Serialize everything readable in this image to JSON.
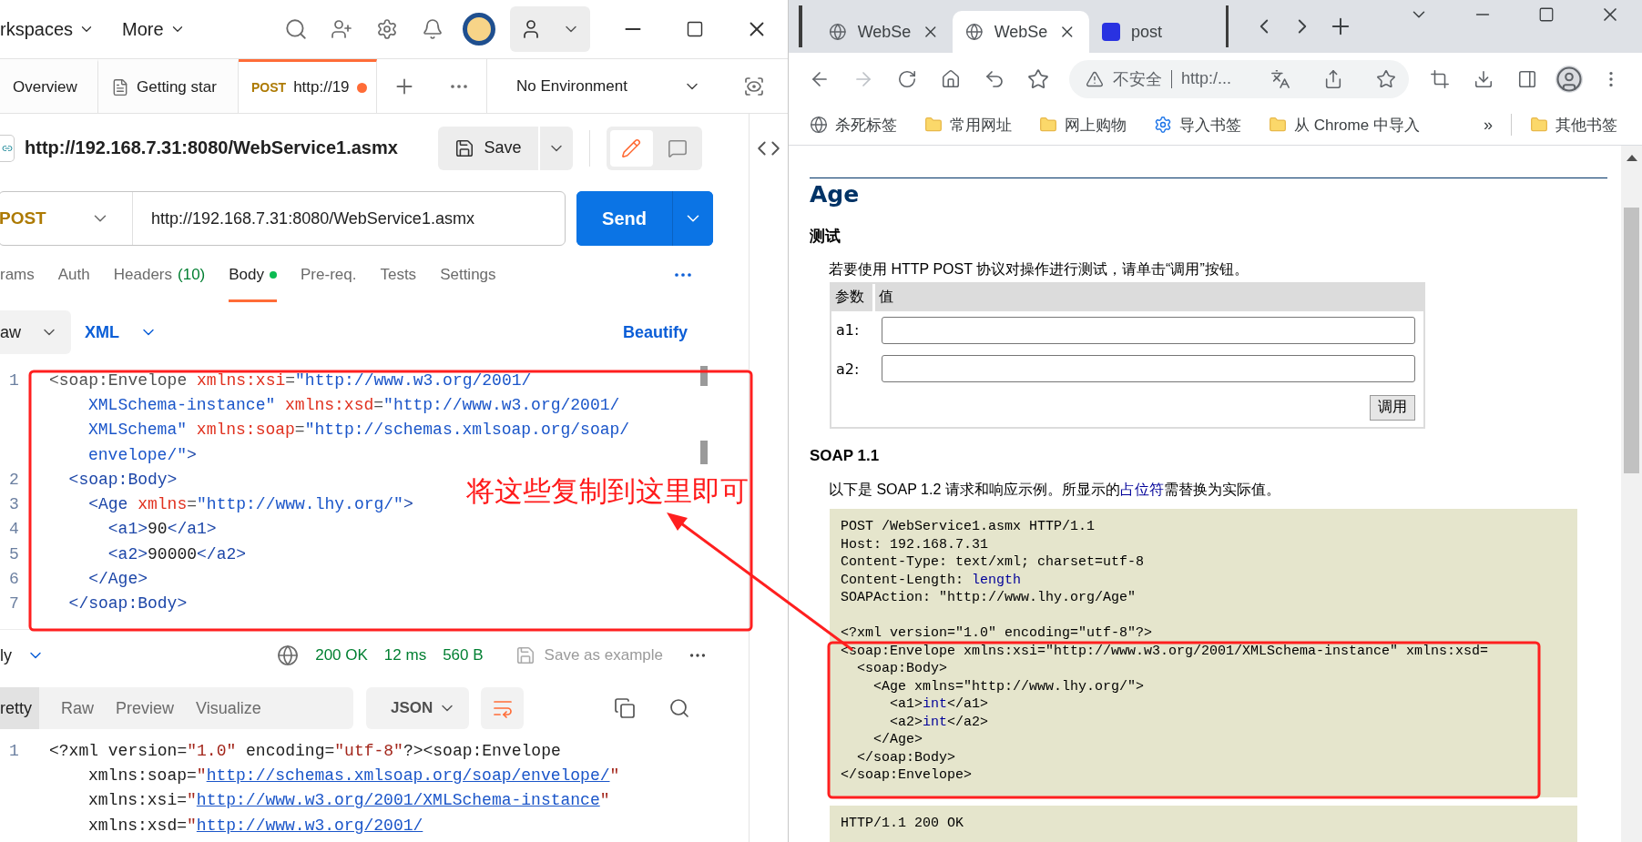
{
  "postman": {
    "top_bar": {
      "workspaces": "rkspaces",
      "more": "More"
    },
    "tabs": [
      {
        "kind": "plain",
        "label": "Overview",
        "selected": false,
        "unsaved": false
      },
      {
        "kind": "doc",
        "label": "Getting star",
        "selected": false,
        "unsaved": false
      },
      {
        "kind": "request",
        "method": "POST",
        "label": "http://19",
        "selected": true,
        "unsaved": true
      }
    ],
    "environment": "No Environment",
    "request_title": "http://192.168.7.31:8080/WebService1.asmx",
    "save_button": "Save",
    "method": "POST",
    "url": "http://192.168.7.31:8080/WebService1.asmx",
    "send_button": "Send",
    "request_tabs": [
      {
        "label": "rams",
        "selected": false,
        "dot": false
      },
      {
        "label": "Auth",
        "selected": false,
        "dot": false
      },
      {
        "label": "Headers",
        "count": "(10)",
        "selected": false,
        "dot": false
      },
      {
        "label": "Body",
        "selected": true,
        "dot": true
      },
      {
        "label": "Pre-req.",
        "selected": false,
        "dot": false
      },
      {
        "label": "Tests",
        "selected": false,
        "dot": false
      },
      {
        "label": "Settings",
        "selected": false,
        "dot": false
      }
    ],
    "body_type": "aw",
    "body_language": "XML",
    "beautify": "Beautify",
    "body_lines": [
      {
        "number": "1",
        "segments": [
          {
            "kind": "plain",
            "text": "<soap:Envelope "
          },
          {
            "kind": "attr",
            "text": "xmlns:xsi"
          },
          {
            "kind": "plain",
            "text": "="
          },
          {
            "kind": "string",
            "text": "\"http://www.w3.org/2001/"
          }
        ]
      },
      {
        "segments": [
          {
            "kind": "string",
            "text": "XMLSchema-instance\" "
          },
          {
            "kind": "attr",
            "text": "xmlns:xsd"
          },
          {
            "kind": "plain",
            "text": "="
          },
          {
            "kind": "string",
            "text": "\"http://www.w3.org/2001/"
          }
        ]
      },
      {
        "segments": [
          {
            "kind": "string",
            "text": "XMLSchema\" "
          },
          {
            "kind": "attr",
            "text": "xmlns:soap"
          },
          {
            "kind": "plain",
            "text": "="
          },
          {
            "kind": "string",
            "text": "\"http://schemas.xmlsoap.org/soap/"
          }
        ]
      },
      {
        "segments": [
          {
            "kind": "string",
            "text": "envelope/\""
          },
          {
            "kind": "tag",
            "text": ">"
          }
        ]
      },
      {
        "number": "2",
        "segments": [
          {
            "kind": "tag",
            "text": "  <soap:Body>"
          }
        ]
      },
      {
        "number": "3",
        "segments": [
          {
            "kind": "tag",
            "text": "    <Age "
          },
          {
            "kind": "attr",
            "text": "xmlns"
          },
          {
            "kind": "plain",
            "text": "="
          },
          {
            "kind": "string",
            "text": "\"http://www.lhy.org/\""
          },
          {
            "kind": "tag",
            "text": ">"
          }
        ]
      },
      {
        "number": "4",
        "segments": [
          {
            "kind": "tag",
            "text": "      <a1>"
          },
          {
            "kind": "text",
            "text": "90"
          },
          {
            "kind": "tag",
            "text": "</a1>"
          }
        ]
      },
      {
        "number": "5",
        "segments": [
          {
            "kind": "tag",
            "text": "      <a2>"
          },
          {
            "kind": "text",
            "text": "90000"
          },
          {
            "kind": "tag",
            "text": "</a2>"
          }
        ]
      },
      {
        "number": "6",
        "segments": [
          {
            "kind": "tag",
            "text": "    </Age>"
          }
        ]
      },
      {
        "number": "7",
        "segments": [
          {
            "kind": "tag",
            "text": "  </soap:Body>"
          }
        ]
      }
    ],
    "response": {
      "body_label": "ly",
      "status": "200 OK",
      "time": "12 ms",
      "size": "560 B",
      "save_example": "Save as example",
      "view_tabs": [
        {
          "label": "retty",
          "selected": true
        },
        {
          "label": "Raw",
          "selected": false
        },
        {
          "label": "Preview",
          "selected": false
        },
        {
          "label": "Visualize",
          "selected": false
        }
      ],
      "format": "JSON",
      "lines": [
        {
          "number": "1",
          "segments": [
            {
              "kind": "plain",
              "text": "<?xml version="
            },
            {
              "kind": "string",
              "text": "\"1.0\""
            },
            {
              "kind": "plain",
              "text": " encoding="
            },
            {
              "kind": "string",
              "text": "\"utf-8\""
            },
            {
              "kind": "plain",
              "text": "?><soap:Envelope"
            }
          ]
        },
        {
          "segments": [
            {
              "kind": "plain",
              "text": "xmlns:soap="
            },
            {
              "kind": "string",
              "text": "\""
            },
            {
              "kind": "link",
              "text": "http://schemas.xmlsoap.org/soap/envelope/"
            },
            {
              "kind": "string",
              "text": "\""
            }
          ]
        },
        {
          "segments": [
            {
              "kind": "plain",
              "text": "xmlns:xsi="
            },
            {
              "kind": "string",
              "text": "\""
            },
            {
              "kind": "link",
              "text": "http://www.w3.org/2001/XMLSchema-instance"
            },
            {
              "kind": "string",
              "text": "\""
            }
          ]
        },
        {
          "segments": [
            {
              "kind": "plain",
              "text": "xmlns:xsd="
            },
            {
              "kind": "string",
              "text": "\""
            },
            {
              "kind": "link",
              "text": "http://www.w3.org/2001/"
            }
          ]
        }
      ]
    }
  },
  "annotation": {
    "text": "将这些复制到这里即可"
  },
  "browser": {
    "tabs": [
      {
        "kind": "site",
        "title": "WebSe",
        "selected": false
      },
      {
        "kind": "site",
        "title": "WebSe",
        "selected": true
      },
      {
        "kind": "search",
        "title": "post",
        "selected": false
      }
    ],
    "security": "不安全",
    "address": "http:/...",
    "bookmarks": [
      {
        "kind": "site",
        "label": "杀死标签"
      },
      {
        "kind": "folder",
        "label": "常用网址"
      },
      {
        "kind": "folder",
        "label": "网上购物"
      },
      {
        "kind": "settings",
        "label": "导入书签"
      },
      {
        "kind": "folder",
        "label": "从 Chrome 中导入"
      }
    ],
    "bookmarks_more": "»",
    "other_bookmarks": "其他书签",
    "page": {
      "heading": "Age",
      "test_heading": "测试",
      "test_intro": "若要使用 HTTP POST 协议对操作进行测试，请单击“调用”按钮。",
      "param_table": {
        "columns": [
          "参数",
          "值"
        ],
        "rows": [
          {
            "label": "a1:"
          },
          {
            "label": "a2:"
          }
        ],
        "invoke_button": "调用"
      },
      "soap_heading": "SOAP 1.1",
      "soap_intro": {
        "before": "以下是 SOAP 1.2 请求和响应示例。所显示的",
        "link": "占位符",
        "after": "需替换为实际值。"
      },
      "request_example": [
        {
          "gap_before": false,
          "segments": [
            {
              "kind": "code",
              "text": "POST /WebService1.asmx HTTP/1.1"
            }
          ]
        },
        {
          "gap_before": false,
          "segments": [
            {
              "kind": "code",
              "text": "Host: 192.168.7.31"
            }
          ]
        },
        {
          "gap_before": false,
          "segments": [
            {
              "kind": "code",
              "text": "Content-Type: text/xml; charset=utf-8"
            }
          ]
        },
        {
          "gap_before": false,
          "segments": [
            {
              "kind": "code",
              "text": "Content-Length: "
            },
            {
              "kind": "placeholder",
              "text": "length"
            }
          ]
        },
        {
          "gap_before": false,
          "segments": [
            {
              "kind": "code",
              "text": "SOAPAction: \"http://www.lhy.org/Age\""
            }
          ]
        },
        {
          "gap_before": true,
          "segments": [
            {
              "kind": "code",
              "text": "<?xml version=\"1.0\" encoding=\"utf-8\"?>"
            }
          ]
        },
        {
          "gap_before": false,
          "segments": [
            {
              "kind": "code",
              "text": "<soap:Envelope xmlns:xsi=\"http://www.w3.org/2001/XMLSchema-instance\" xmlns:xsd="
            }
          ]
        },
        {
          "gap_before": false,
          "segments": [
            {
              "kind": "code",
              "text": "  <soap:Body>"
            }
          ]
        },
        {
          "gap_before": false,
          "segments": [
            {
              "kind": "code",
              "text": "    <Age xmlns=\"http://www.lhy.org/\">"
            }
          ]
        },
        {
          "gap_before": false,
          "segments": [
            {
              "kind": "code",
              "text": "      <a1>"
            },
            {
              "kind": "placeholder",
              "text": "int"
            },
            {
              "kind": "code",
              "text": "</a1>"
            }
          ]
        },
        {
          "gap_before": false,
          "segments": [
            {
              "kind": "code",
              "text": "      <a2>"
            },
            {
              "kind": "placeholder",
              "text": "int"
            },
            {
              "kind": "code",
              "text": "</a2>"
            }
          ]
        },
        {
          "gap_before": false,
          "segments": [
            {
              "kind": "code",
              "text": "    </Age>"
            }
          ]
        },
        {
          "gap_before": false,
          "segments": [
            {
              "kind": "code",
              "text": "  </soap:Body>"
            }
          ]
        },
        {
          "gap_before": false,
          "segments": [
            {
              "kind": "code",
              "text": "</soap:Envelope>"
            }
          ]
        }
      ],
      "response_example": [
        {
          "gap_before": false,
          "segments": [
            {
              "kind": "code",
              "text": "HTTP/1.1 200 OK"
            }
          ]
        }
      ]
    }
  }
}
